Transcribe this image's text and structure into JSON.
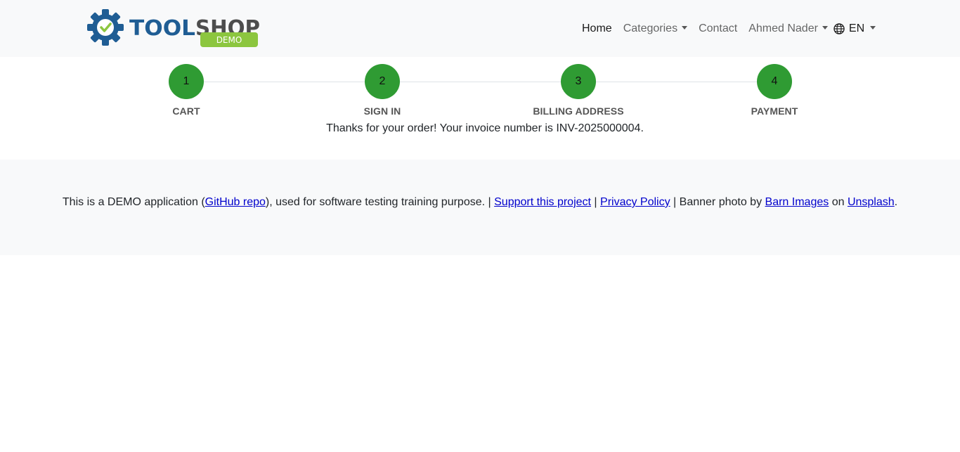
{
  "brand": {
    "logo_part1": "TOOL",
    "logo_part2": "SHOP",
    "badge": "DEMO",
    "colors": {
      "blue": "#1f5d94",
      "gray": "#4d4d4d",
      "green": "#8cc63f"
    }
  },
  "nav": {
    "home": "Home",
    "categories": "Categories",
    "contact": "Contact",
    "user": "Ahmed Nader",
    "language": "EN"
  },
  "steps": [
    {
      "number": "1",
      "label": "CART"
    },
    {
      "number": "2",
      "label": "SIGN IN"
    },
    {
      "number": "3",
      "label": "BILLING ADDRESS"
    },
    {
      "number": "4",
      "label": "PAYMENT"
    }
  ],
  "step_color": "#2f9b33",
  "confirmation": "Thanks for your order! Your invoice number is INV-2025000004.",
  "footer": {
    "t1": "This is a DEMO application (",
    "github": "GitHub repo",
    "t2": "), used for software testing training purpose. | ",
    "support": "Support this project",
    "t3": " | ",
    "privacy": "Privacy Policy",
    "t4": " | Banner photo by ",
    "barn": "Barn Images",
    "t5": " on ",
    "unsplash": "Unsplash",
    "t6": "."
  }
}
